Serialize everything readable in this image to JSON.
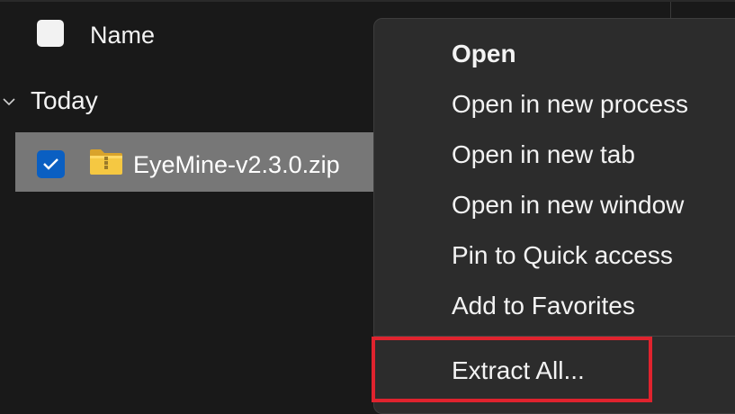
{
  "header": {
    "column_name": "Name"
  },
  "group": {
    "label": "Today",
    "expanded": true
  },
  "file": {
    "name": "EyeMine-v2.3.0.zip",
    "selected": true,
    "icon": "zip-folder-icon"
  },
  "context_menu": {
    "items": [
      {
        "label": "Open",
        "bold": true
      },
      {
        "label": "Open in new process"
      },
      {
        "label": "Open in new tab"
      },
      {
        "label": "Open in new window"
      },
      {
        "label": "Pin to Quick access"
      },
      {
        "label": "Add to Favorites"
      },
      {
        "label": "Extract All..."
      }
    ]
  },
  "colors": {
    "background": "#191919",
    "selection": "#777777",
    "checkbox_accent": "#0a5fc2",
    "menu_background": "#2c2c2c",
    "highlight": "#e0232e"
  }
}
